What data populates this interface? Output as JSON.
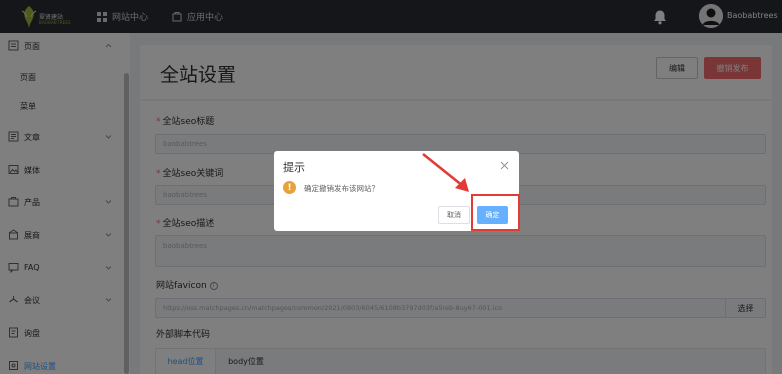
{
  "topbar": {
    "logo_text": "翠贤建站",
    "logo_sub": "BAOBABTREES",
    "nav_site": "网站中心",
    "nav_app": "应用中心",
    "username": "Baobabtrees"
  },
  "sidebar": {
    "items": [
      {
        "label": "页面",
        "icon": "page-icon",
        "expanded": true
      },
      {
        "label": "页面"
      },
      {
        "label": "菜单"
      },
      {
        "label": "文章",
        "icon": "article-icon"
      },
      {
        "label": "媒体",
        "icon": "media-icon"
      },
      {
        "label": "产品",
        "icon": "product-icon"
      },
      {
        "label": "展商",
        "icon": "exhibitor-icon"
      },
      {
        "label": "FAQ",
        "icon": "faq-icon"
      },
      {
        "label": "会议",
        "icon": "meeting-icon"
      },
      {
        "label": "询盘",
        "icon": "inquiry-icon"
      },
      {
        "label": "网站设置",
        "icon": "settings-icon",
        "active": true
      }
    ]
  },
  "header": {
    "title": "全站设置",
    "edit_label": "编辑",
    "unpublish_label": "撤销发布"
  },
  "form": {
    "seo_title_label": "全站seo标题",
    "seo_title_value": "baobabtrees",
    "seo_keywords_label": "全站seo关键词",
    "seo_keywords_value": "baobabtrees",
    "seo_desc_label": "全站seo描述",
    "seo_desc_value": "baobabtrees",
    "favicon_label": "网站favicon",
    "favicon_url": "https://oss.matchpages.cn/matchpages/common/2021/0803/6045/6108b3797d03f/a5reb-8uy67-001.ico",
    "select_label": "选择",
    "script_label": "外部脚本代码",
    "tab_head": "head位置",
    "tab_body": "body位置"
  },
  "dialog": {
    "title": "提示",
    "message": "确定撤销发布该网站？",
    "cancel_label": "取消",
    "ok_label": "确定"
  },
  "colors": {
    "topbar": "#2b2d33",
    "accent": "#409eff",
    "danger": "#f56c6c",
    "warning": "#e6a23c",
    "annotation": "#e53935"
  }
}
